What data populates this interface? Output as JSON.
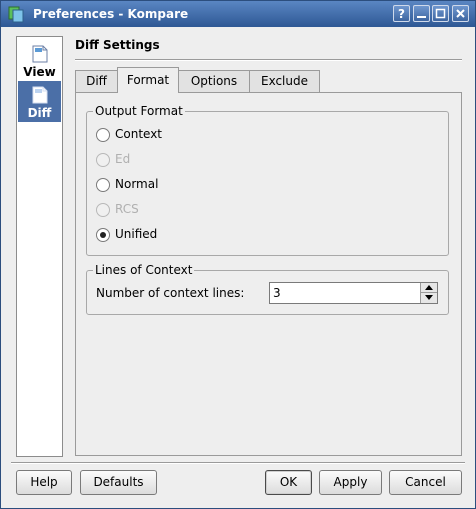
{
  "window": {
    "title": "Preferences - Kompare",
    "buttons": {
      "help": "?"
    }
  },
  "sidebar": {
    "items": [
      {
        "label": "View",
        "icon": "document-icon",
        "selected": false
      },
      {
        "label": "Diff",
        "icon": "document-icon",
        "selected": true
      }
    ]
  },
  "page": {
    "title": "Diff Settings",
    "tabs": [
      {
        "label": "Diff",
        "active": false
      },
      {
        "label": "Format",
        "active": true
      },
      {
        "label": "Options",
        "active": false
      },
      {
        "label": "Exclude",
        "active": false
      }
    ]
  },
  "output_format": {
    "title": "Output Format",
    "options": [
      {
        "label": "Context",
        "selected": false,
        "enabled": true
      },
      {
        "label": "Ed",
        "selected": false,
        "enabled": false
      },
      {
        "label": "Normal",
        "selected": false,
        "enabled": true
      },
      {
        "label": "RCS",
        "selected": false,
        "enabled": false
      },
      {
        "label": "Unified",
        "selected": true,
        "enabled": true
      }
    ]
  },
  "lines_of_context": {
    "title": "Lines of Context",
    "label": "Number of context lines:",
    "value": "3"
  },
  "buttons": {
    "help": "Help",
    "defaults": "Defaults",
    "ok": "OK",
    "apply": "Apply",
    "cancel": "Cancel"
  },
  "colors": {
    "titlebar": "#3a6aa8",
    "selection": "#4b6fa7",
    "background": "#eeeeee"
  }
}
